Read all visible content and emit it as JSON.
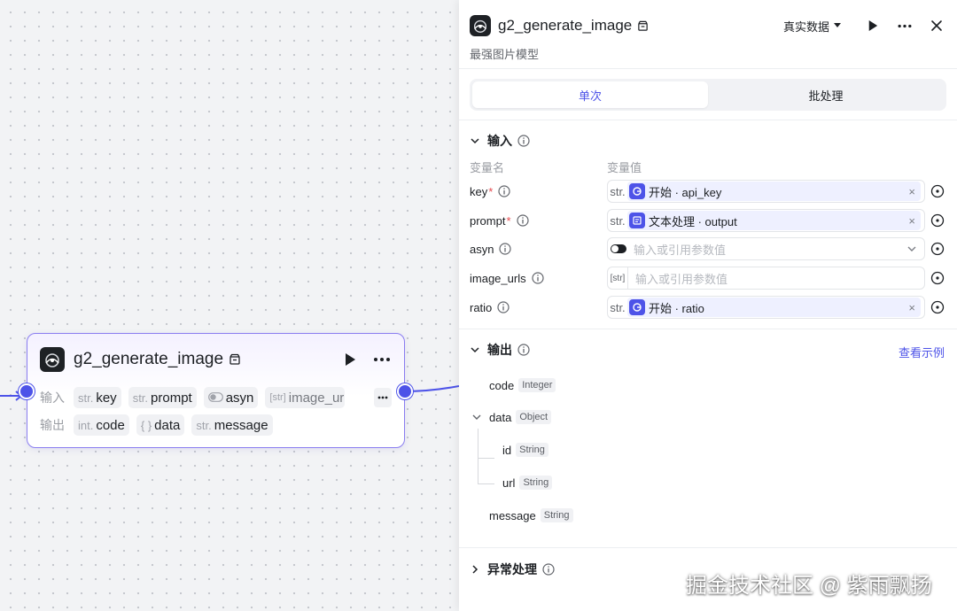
{
  "canvas_node": {
    "title": "g2_generate_image",
    "input_label": "输入",
    "output_label": "输出",
    "inputs": [
      {
        "type": "str.",
        "name": "key"
      },
      {
        "type": "str.",
        "name": "prompt"
      },
      {
        "type": "toggle",
        "name": "asyn"
      },
      {
        "type": "[str]",
        "name": "image_url"
      }
    ],
    "outputs": [
      {
        "type": "int.",
        "name": "code"
      },
      {
        "type": "{ }",
        "name": "data"
      },
      {
        "type": "str.",
        "name": "message"
      }
    ]
  },
  "panel": {
    "title": "g2_generate_image",
    "description": "最强图片模型",
    "data_source": "真实数据",
    "tabs": [
      {
        "label": "单次",
        "active": true
      },
      {
        "label": "批处理",
        "active": false
      }
    ],
    "input_section": {
      "title": "输入",
      "col_name": "变量名",
      "col_value": "变量值",
      "params": [
        {
          "name": "key",
          "required": true,
          "type": "str.",
          "ref_source": "开始",
          "ref_var": "api_key",
          "ref_text": "开始 · api_key",
          "placeholder": ""
        },
        {
          "name": "prompt",
          "required": true,
          "type": "str.",
          "ref_source": "文本处理",
          "ref_var": "output",
          "ref_text": "文本处理 · output",
          "placeholder": ""
        },
        {
          "name": "asyn",
          "required": false,
          "type": "toggle",
          "ref_text": "",
          "placeholder": "输入或引用参数值"
        },
        {
          "name": "image_urls",
          "required": false,
          "type": "[str]",
          "ref_text": "",
          "placeholder": "输入或引用参数值"
        },
        {
          "name": "ratio",
          "required": false,
          "type": "str.",
          "ref_source": "开始",
          "ref_var": "ratio",
          "ref_text": "开始 · ratio",
          "placeholder": ""
        }
      ]
    },
    "output_section": {
      "title": "输出",
      "view_example": "查看示例",
      "items": [
        {
          "name": "code",
          "type": "Integer"
        },
        {
          "name": "data",
          "type": "Object",
          "children": [
            {
              "name": "id",
              "type": "String"
            },
            {
              "name": "url",
              "type": "String"
            }
          ]
        },
        {
          "name": "message",
          "type": "String"
        }
      ]
    },
    "error_section": {
      "title": "异常处理"
    }
  },
  "watermark": "掘金技术社区 @ 紫雨飘扬",
  "colors": {
    "accent": "#4d53e8",
    "node_border": "#8a7df0",
    "required": "#e5484d",
    "canvas_bg": "#f2f3f5"
  }
}
